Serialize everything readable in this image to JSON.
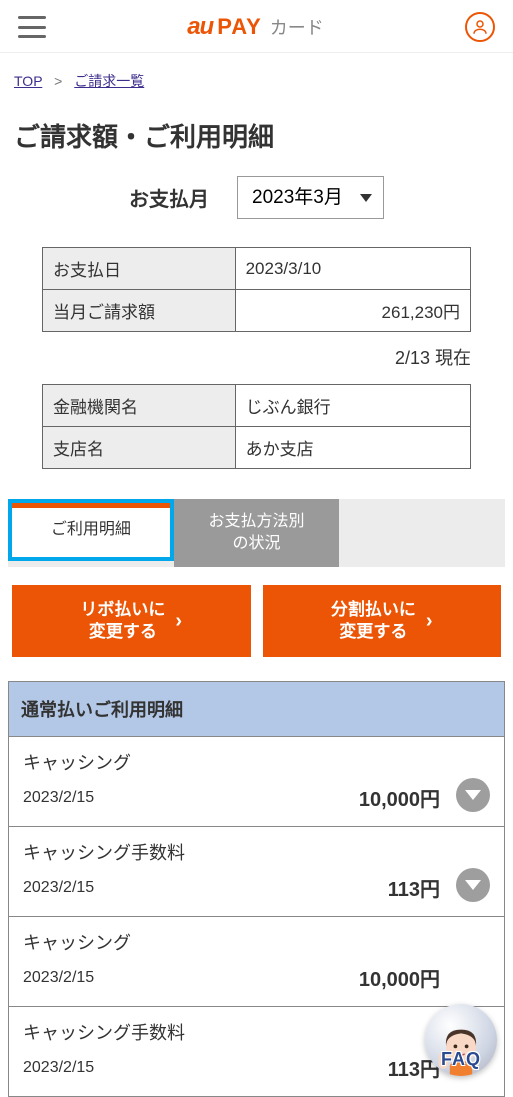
{
  "header": {
    "logo_au": "au",
    "logo_pay": "PAY",
    "logo_card": "カード"
  },
  "breadcrumb": {
    "top": "TOP",
    "sep": ">",
    "current": "ご請求一覧"
  },
  "page_title": "ご請求額・ご利用明細",
  "month": {
    "label": "お支払月",
    "selected": "2023年3月"
  },
  "summary": {
    "pay_date_label": "お支払日",
    "pay_date": "2023/3/10",
    "amount_label": "当月ご請求額",
    "amount": "261,230円",
    "as_of": "2/13 現在",
    "bank_label": "金融機関名",
    "bank": "じぶん銀行",
    "branch_label": "支店名",
    "branch": "あか支店"
  },
  "tabs": {
    "t1": "ご利用明細",
    "t2": "お支払方法別\nの状況"
  },
  "actions": {
    "revo": "リボ払いに\n変更する",
    "split": "分割払いに\n変更する"
  },
  "detail": {
    "header": "通常払いご利用明細",
    "rows": [
      {
        "title": "キャッシング",
        "date": "2023/2/15",
        "amount": "10,000円",
        "expandable": true
      },
      {
        "title": "キャッシング手数料",
        "date": "2023/2/15",
        "amount": "113円",
        "expandable": true
      },
      {
        "title": "キャッシング",
        "date": "2023/2/15",
        "amount": "10,000円",
        "expandable": false
      },
      {
        "title": "キャッシング手数料",
        "date": "2023/2/15",
        "amount": "113円",
        "expandable": false
      }
    ]
  },
  "faq_label": "FAQ"
}
